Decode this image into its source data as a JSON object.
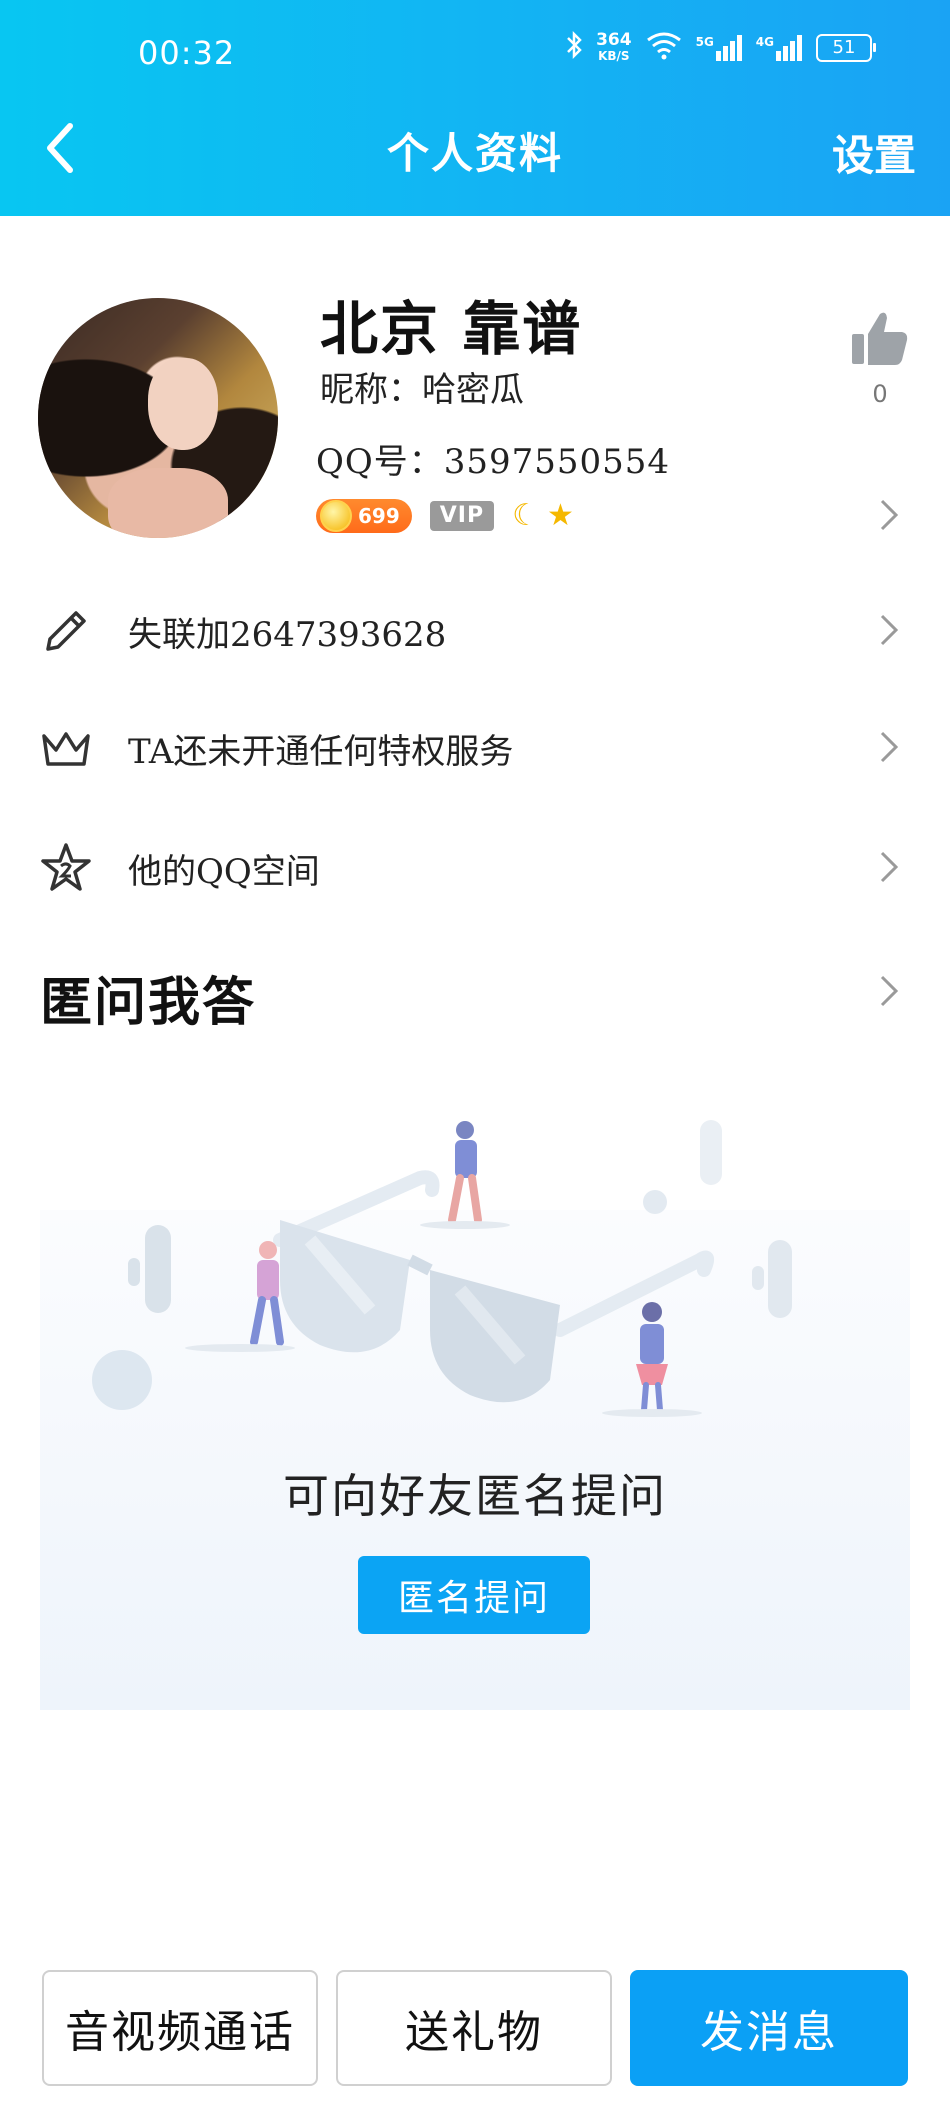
{
  "status_bar": {
    "time": "00:32",
    "network_speed_top": "364",
    "network_speed_unit": "KB/S",
    "signal_5g": "5G",
    "signal_4g": "4G",
    "battery": "51"
  },
  "header": {
    "title": "个人资料",
    "settings_label": "设置"
  },
  "profile": {
    "name": "北京 靠谱",
    "nickname": "昵称：哈密瓜",
    "qq": "QQ号：3597550554",
    "coin_level": "699",
    "vip_label": "VIP",
    "like_count": "0"
  },
  "menu": [
    {
      "label": "失联加2647393628",
      "icon": "pencil-icon"
    },
    {
      "label": "TA还未开通任何特权服务",
      "icon": "crown-icon"
    },
    {
      "label": "他的QQ空间",
      "icon": "star-icon"
    }
  ],
  "qa": {
    "title": "匿问我答",
    "prompt": "可向好友匿名提问",
    "button": "匿名提问"
  },
  "bottom_bar": {
    "call": "音视频通话",
    "gift": "送礼物",
    "message": "发消息"
  },
  "colors": {
    "header_start": "#08c6f2",
    "header_end": "#1aa3f4",
    "primary": "#0ba0f5"
  }
}
